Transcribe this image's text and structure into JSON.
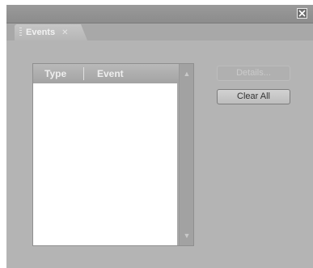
{
  "window": {
    "close_icon": "close-icon"
  },
  "panel": {
    "tab_label": "Events",
    "tab_close_glyph": "✕"
  },
  "list": {
    "columns": [
      "Type",
      "Event"
    ],
    "rows": []
  },
  "buttons": {
    "details_label": "Details...",
    "details_enabled": false,
    "clear_all_label": "Clear All"
  }
}
